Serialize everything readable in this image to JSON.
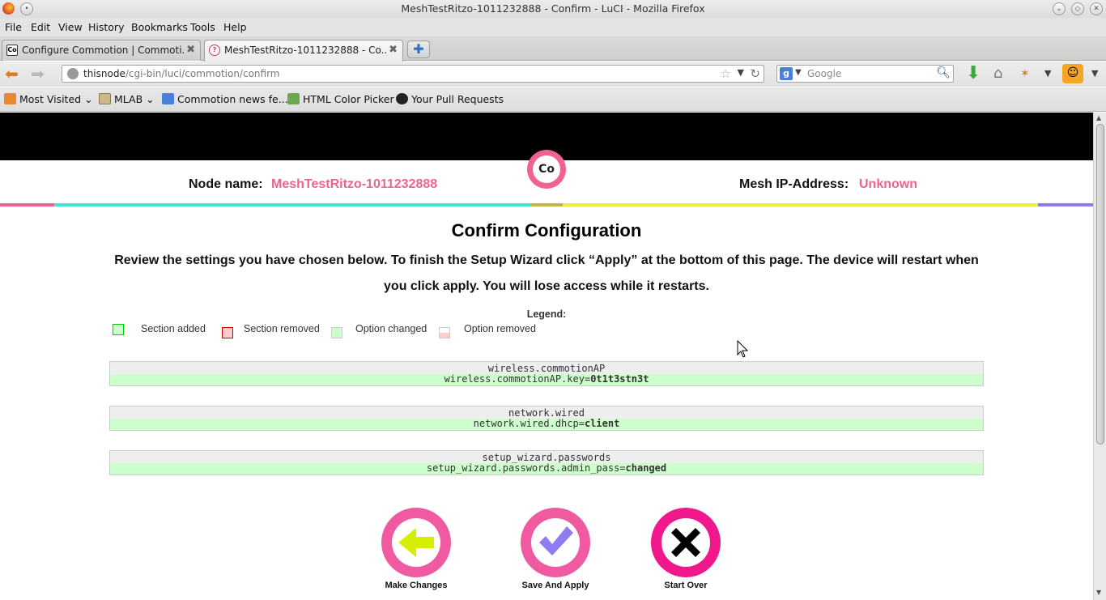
{
  "window": {
    "title": "MeshTestRitzo-1011232888 - Confirm - LuCI - Mozilla Firefox"
  },
  "menu": {
    "items": [
      "File",
      "Edit",
      "View",
      "History",
      "Bookmarks",
      "Tools",
      "Help"
    ]
  },
  "tabs": [
    {
      "label": "Configure Commotion | Commoti...",
      "favicon": "Co",
      "active": false
    },
    {
      "label": "MeshTestRitzo-1011232888 - Co...",
      "favicon": "?",
      "active": true
    }
  ],
  "navbar": {
    "url_host": "thisnode",
    "url_path": "/cgi-bin/luci/commotion/confirm",
    "search_placeholder": "Google",
    "search_engine_letter": "g"
  },
  "bookmarks": [
    {
      "label": "Most Visited",
      "has_dropdown": true,
      "icon": "fire-icon"
    },
    {
      "label": "MLAB",
      "has_dropdown": true,
      "icon": "folder-icon"
    },
    {
      "label": "Commotion news fe...",
      "has_dropdown": false,
      "icon": "google-reader-icon"
    },
    {
      "label": "HTML Color Picker",
      "has_dropdown": false,
      "icon": "w3-icon"
    },
    {
      "label": "Your Pull Requests",
      "has_dropdown": false,
      "icon": "github-icon"
    }
  ],
  "header": {
    "logo_text": "Co",
    "node_name_label": "Node name:",
    "node_name_value": "MeshTestRitzo-1011232888",
    "mesh_ip_label": "Mesh IP-Address:",
    "mesh_ip_value": "Unknown"
  },
  "colors": {
    "accent_pink": "#f06292",
    "stripe_pink": "#f06292",
    "stripe_teal": "#3ee8d2",
    "stripe_olive": "#c8b440",
    "stripe_yellow": "#e8f03a",
    "stripe_purple": "#8e7cf0",
    "added_green": "#ccffcc",
    "removed_red": "#ffcccc"
  },
  "main": {
    "title": "Confirm Configuration",
    "intro_line1": "Review the settings you have chosen below. To finish the Setup Wizard click “Apply” at the bottom of this page. The device will restart when",
    "intro_line2": "you click apply. You will lose access while it restarts."
  },
  "legend": {
    "title": "Legend:",
    "items": [
      "Section added",
      "Section removed",
      "Option changed",
      "Option removed"
    ]
  },
  "changes": [
    {
      "section": "wireless.commotionAP",
      "option_key": "wireless.commotionAP.key=",
      "option_value": "0t1t3stn3t"
    },
    {
      "section": "network.wired",
      "option_key": "network.wired.dhcp=",
      "option_value": "client"
    },
    {
      "section": "setup_wizard.passwords",
      "option_key": "setup_wizard.passwords.admin_pass=",
      "option_value": "changed"
    }
  ],
  "actions": {
    "make_changes": "Make Changes",
    "save_apply": "Save And Apply",
    "start_over": "Start Over"
  }
}
